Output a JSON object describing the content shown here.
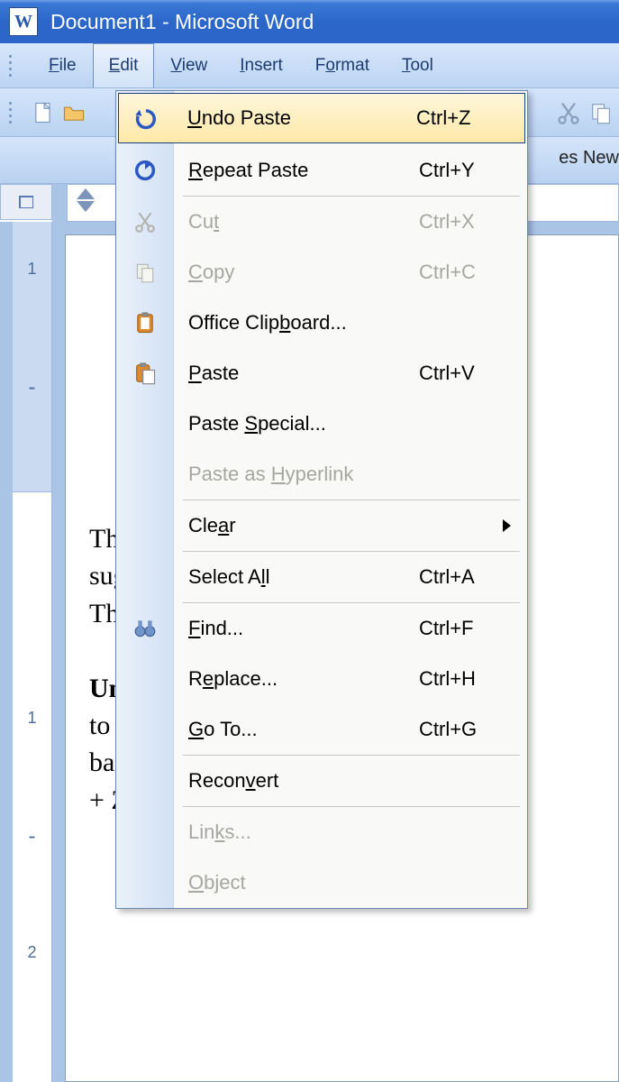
{
  "window": {
    "title": "Document1 - Microsoft Word"
  },
  "menubar": {
    "file": {
      "label": "File",
      "mnemonic": "F"
    },
    "edit": {
      "label": "Edit",
      "mnemonic": "E"
    },
    "view": {
      "label": "View",
      "mnemonic": "V"
    },
    "insert": {
      "label": "Insert",
      "mnemonic": "I"
    },
    "format": {
      "label": "Format",
      "mnemonic": "o"
    },
    "tools": {
      "label": "Tools",
      "mnemonic": "T"
    }
  },
  "fontbar": {
    "font_name_fragment": "es New"
  },
  "edit_menu": {
    "undo": {
      "label": "Undo Paste",
      "shortcut": "Ctrl+Z",
      "enabled": true,
      "mnemonic": "U"
    },
    "repeat": {
      "label": "Repeat Paste",
      "shortcut": "Ctrl+Y",
      "enabled": true,
      "mnemonic": "R"
    },
    "cut": {
      "label": "Cut",
      "shortcut": "Ctrl+X",
      "enabled": false,
      "mnemonic": "t"
    },
    "copy": {
      "label": "Copy",
      "shortcut": "Ctrl+C",
      "enabled": false,
      "mnemonic": "C"
    },
    "clipboard": {
      "label": "Office Clipboard...",
      "shortcut": "",
      "enabled": true,
      "mnemonic": "B"
    },
    "paste": {
      "label": "Paste",
      "shortcut": "Ctrl+V",
      "enabled": true,
      "mnemonic": "P"
    },
    "paste_special": {
      "label": "Paste Special...",
      "shortcut": "",
      "enabled": true,
      "mnemonic": "S"
    },
    "paste_hyperlink": {
      "label": "Paste as Hyperlink",
      "shortcut": "",
      "enabled": false,
      "mnemonic": "H"
    },
    "clear": {
      "label": "Clear",
      "shortcut": "",
      "enabled": true,
      "submenu": true,
      "mnemonic": "a"
    },
    "select_all": {
      "label": "Select All",
      "shortcut": "Ctrl+A",
      "enabled": true,
      "mnemonic": "l"
    },
    "find": {
      "label": "Find...",
      "shortcut": "Ctrl+F",
      "enabled": true,
      "mnemonic": "F"
    },
    "replace": {
      "label": "Replace...",
      "shortcut": "Ctrl+H",
      "enabled": true,
      "mnemonic": "e"
    },
    "goto": {
      "label": "Go To...",
      "shortcut": "Ctrl+G",
      "enabled": true,
      "mnemonic": "G"
    },
    "reconvert": {
      "label": "Reconvert",
      "shortcut": "",
      "enabled": true,
      "mnemonic": "v"
    },
    "links": {
      "label": "Links...",
      "shortcut": "",
      "enabled": false,
      "mnemonic": "k"
    },
    "object": {
      "label": "Object",
      "shortcut": "",
      "enabled": false,
      "mnemonic": "O"
    }
  },
  "vruler_marks": [
    "1",
    "-",
    "1",
    "-",
    "2"
  ],
  "document_text_fragments": {
    "line1": "The",
    "line2": "sugg",
    "line3": "Thes",
    "line4": "",
    "line5_bold": "Und",
    "line6": "to g",
    "line7": "back",
    "line8": "+ Z"
  }
}
